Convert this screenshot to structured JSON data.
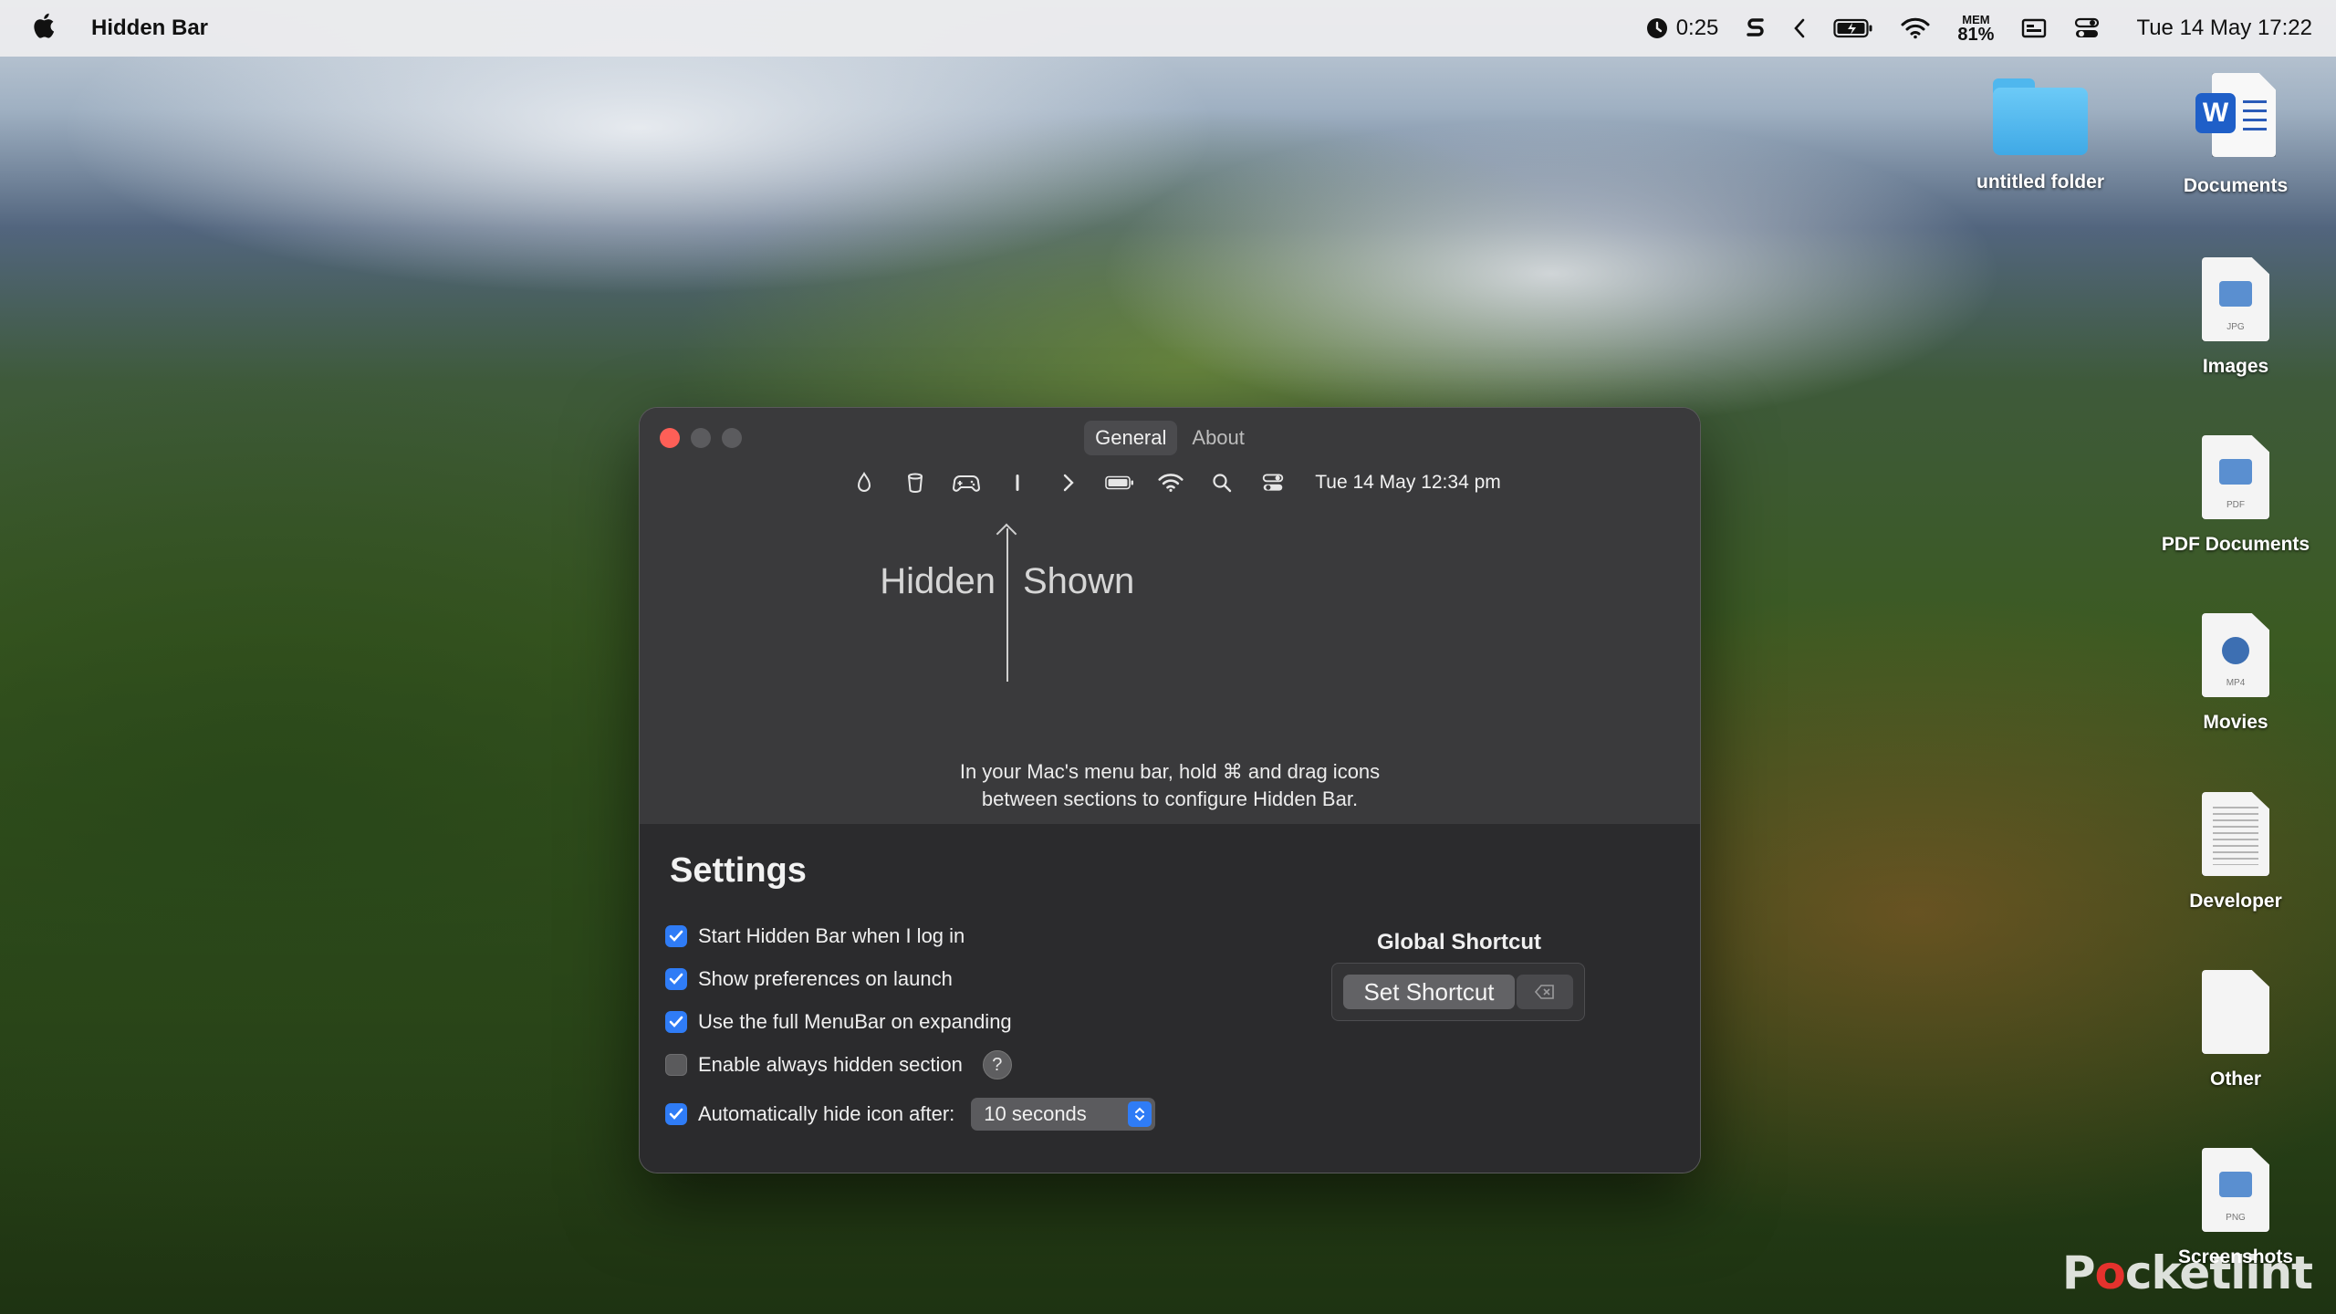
{
  "menubar": {
    "app_name": "Hidden Bar",
    "timer": "0:25",
    "mem_label": "MEM",
    "mem_value": "81%",
    "datetime": "Tue 14 May  17:22",
    "icons": [
      "apple-icon",
      "timer-icon",
      "s-app-icon",
      "chevron-left-icon",
      "battery-charging-icon",
      "wifi-icon",
      "memory-icon",
      "display-icon",
      "control-center-icon"
    ]
  },
  "desktop": {
    "items": [
      {
        "label": "untitled folder",
        "type": "folder"
      },
      {
        "label": "Documents",
        "type": "word"
      },
      {
        "label": "Images",
        "tag": "JPG"
      },
      {
        "label": "PDF Documents",
        "tag": "PDF"
      },
      {
        "label": "Movies",
        "tag": "MP4"
      },
      {
        "label": "Developer",
        "tag": ""
      },
      {
        "label": "Other",
        "tag": ""
      },
      {
        "label": "Screenshots",
        "tag": "PNG"
      }
    ]
  },
  "window": {
    "tabs": [
      {
        "label": "General",
        "active": true
      },
      {
        "label": "About",
        "active": false
      }
    ],
    "preview": {
      "icons": [
        "droplet-icon",
        "cup-icon",
        "gamepad-icon",
        "separator-bar-icon",
        "chevron-right-icon",
        "battery-icon",
        "wifi-icon",
        "search-icon",
        "control-center-icon"
      ],
      "datetime": "Tue 14 May 12:34 pm"
    },
    "hidden_label": "Hidden",
    "shown_label": "Shown",
    "instructions_line1": "In your Mac's menu bar, hold ⌘ and drag icons",
    "instructions_line2": "between sections to configure Hidden Bar.",
    "settings": {
      "title": "Settings",
      "options": [
        {
          "label": "Start Hidden Bar when I log in",
          "checked": true
        },
        {
          "label": "Show preferences on launch",
          "checked": true
        },
        {
          "label": "Use the full MenuBar on expanding",
          "checked": true
        },
        {
          "label": "Enable always hidden section",
          "checked": false
        },
        {
          "label": "Automatically hide icon after:",
          "checked": true
        }
      ],
      "help_label": "?",
      "hide_after_value": "10 seconds"
    },
    "global_shortcut": {
      "title": "Global Shortcut",
      "button_label": "Set Shortcut"
    }
  },
  "watermark": {
    "prefix": "P",
    "accent": "o",
    "suffix": "cketlint"
  },
  "colors": {
    "accent": "#2f7cf6",
    "close": "#fe5f57",
    "window_bg": "#363638",
    "settings_bg": "#2b2b2d"
  }
}
